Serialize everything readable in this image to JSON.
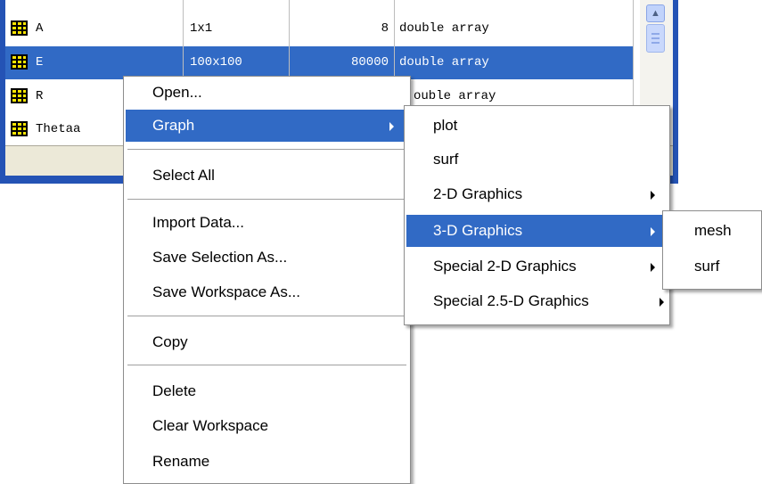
{
  "workspace": {
    "rows": [
      {
        "name": "A",
        "size": "1x1",
        "bytes": "8",
        "class": "double array",
        "selected": false
      },
      {
        "name": "E",
        "size": "100x100",
        "bytes": "80000",
        "class": "double array",
        "selected": true
      },
      {
        "name": "R",
        "size": "",
        "bytes": "",
        "class": "ouble array",
        "selected": false
      },
      {
        "name": "Thetaa",
        "size": "",
        "bytes": "",
        "class": "",
        "selected": false
      }
    ]
  },
  "context_menu": {
    "open": "Open...",
    "graph": "Graph",
    "select_all": "Select All",
    "import_data": "Import Data...",
    "save_selection_as": "Save Selection As...",
    "save_workspace_as": "Save Workspace As...",
    "copy": "Copy",
    "delete": "Delete",
    "clear_workspace": "Clear Workspace",
    "rename": "Rename"
  },
  "graph_menu": {
    "plot": "plot",
    "surf": "surf",
    "graphics_2d": "2-D Graphics",
    "graphics_3d": "3-D Graphics",
    "special_2d": "Special 2-D Graphics",
    "special_25d": "Special 2.5-D Graphics"
  },
  "graphics_3d_menu": {
    "mesh": "mesh",
    "surf": "surf"
  },
  "colors": {
    "selection": "#316ac5",
    "window_border": "#2453b5",
    "variable_icon": "#ffe600"
  }
}
